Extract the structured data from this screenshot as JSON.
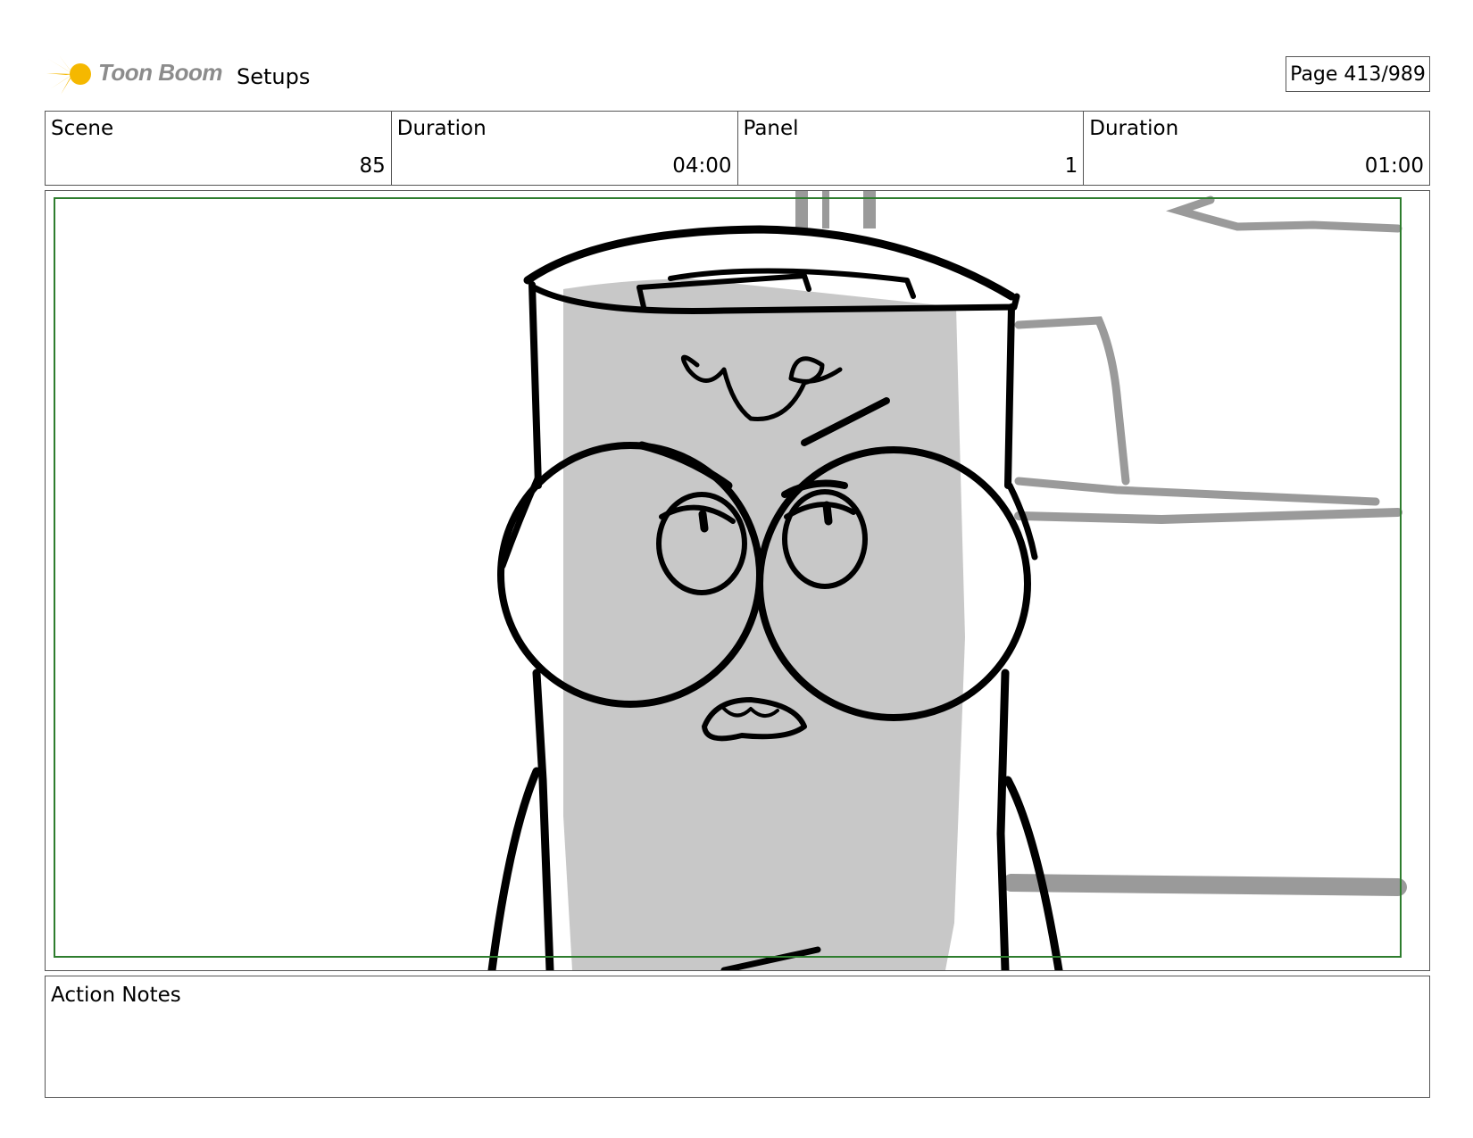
{
  "header": {
    "logo_text": "Toon Boom",
    "title": "Setups",
    "page_indicator": "Page 413/989"
  },
  "info": [
    {
      "label": "Scene",
      "value": "85"
    },
    {
      "label": "Duration",
      "value": "04:00"
    },
    {
      "label": "Panel",
      "value": "1"
    },
    {
      "label": "Duration",
      "value": "01:00"
    }
  ],
  "notes": {
    "label": "Action Notes"
  },
  "colors": {
    "safe_frame": "#2e7d2e",
    "sketch_gray": "#c8c8c8",
    "background_gray": "#9a9a9a"
  }
}
